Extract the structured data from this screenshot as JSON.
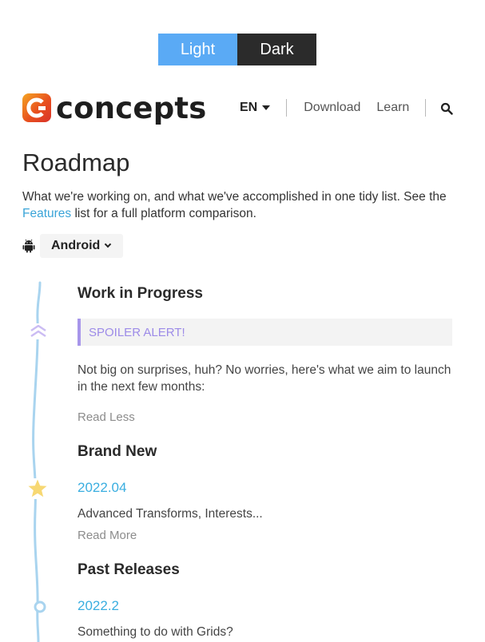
{
  "theme_toggle": {
    "light_label": "Light",
    "dark_label": "Dark"
  },
  "header": {
    "logo_text": "concepts",
    "language": "EN",
    "nav": {
      "download": "Download",
      "learn": "Learn"
    },
    "icons": {
      "logo": "concepts-logo-icon",
      "search": "search-icon"
    }
  },
  "page": {
    "title": "Roadmap",
    "intro_before_link": "What we're working on, and what we've accomplished in one tidy list. See the ",
    "intro_link": "Features",
    "intro_after_link": " list for a full platform comparison."
  },
  "platform": {
    "selected": "Android",
    "icon": "android-icon"
  },
  "sections": {
    "wip": {
      "heading": "Work in Progress",
      "spoiler": "SPOILER ALERT!",
      "text": "Not big on surprises, huh? No worries, here's what we aim to launch in the next few months:",
      "toggle": "Read Less"
    },
    "brand_new": {
      "heading": "Brand New",
      "version": "2022.04",
      "text": "Advanced Transforms, Interests...",
      "toggle": "Read More"
    },
    "past": {
      "heading": "Past Releases",
      "version": "2022.2",
      "text": "Something to do with Grids?"
    }
  },
  "colors": {
    "accent_blue": "#3aaee0",
    "timeline_line": "#a9d4ef",
    "spoiler_purple": "#a796ea",
    "star_yellow": "#f7d873"
  }
}
